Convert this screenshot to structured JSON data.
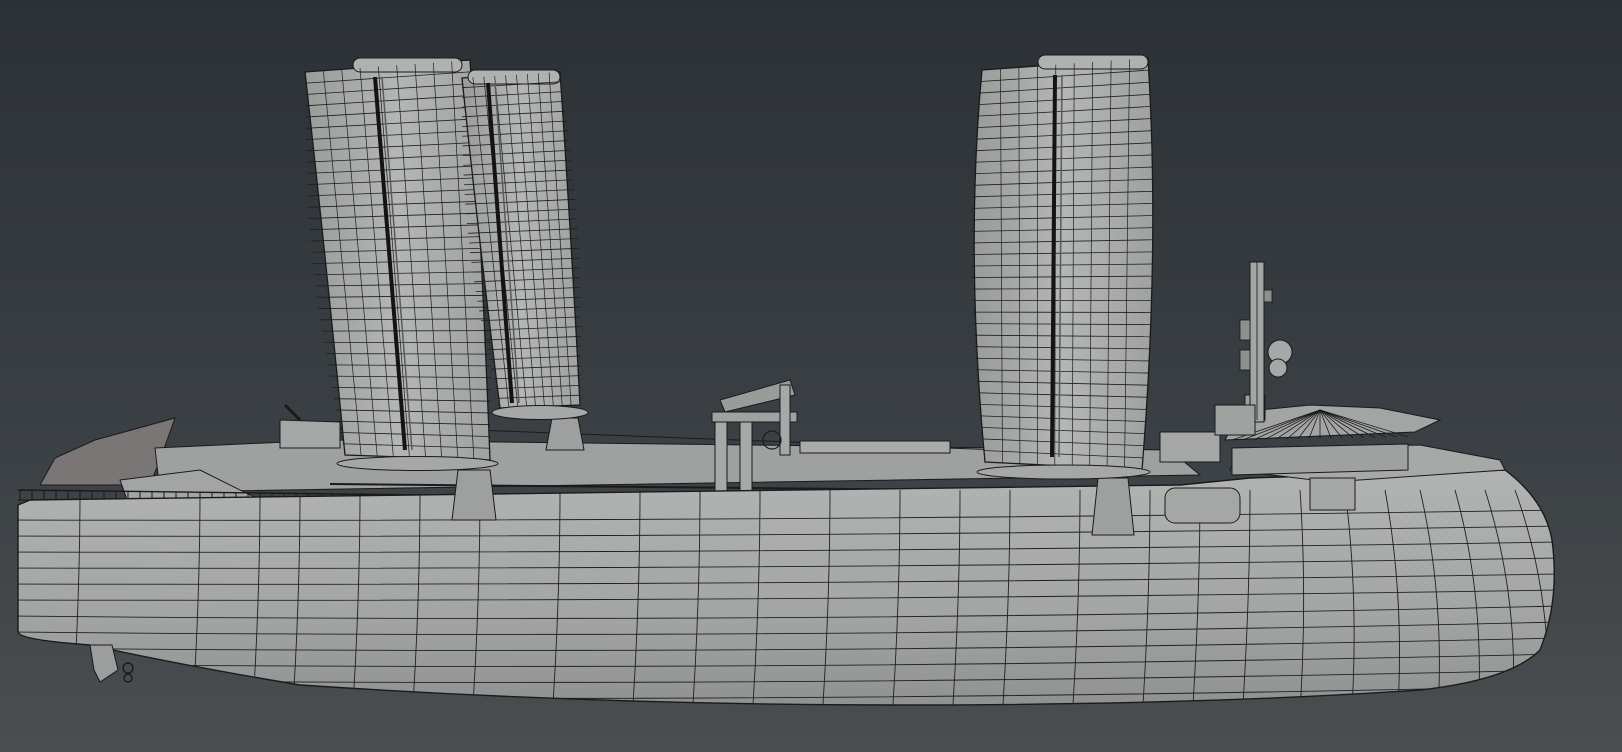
{
  "viewport": {
    "background_top": "#2c3135",
    "background_bottom": "#4a4e51",
    "shading": "wireframe-on-shaded",
    "model_color": "#a6a8a8",
    "wire_color": "#1c1c1c"
  },
  "model": {
    "subject": "cargo-ship-with-rotor-sails",
    "rotor_sail_count": 3
  }
}
